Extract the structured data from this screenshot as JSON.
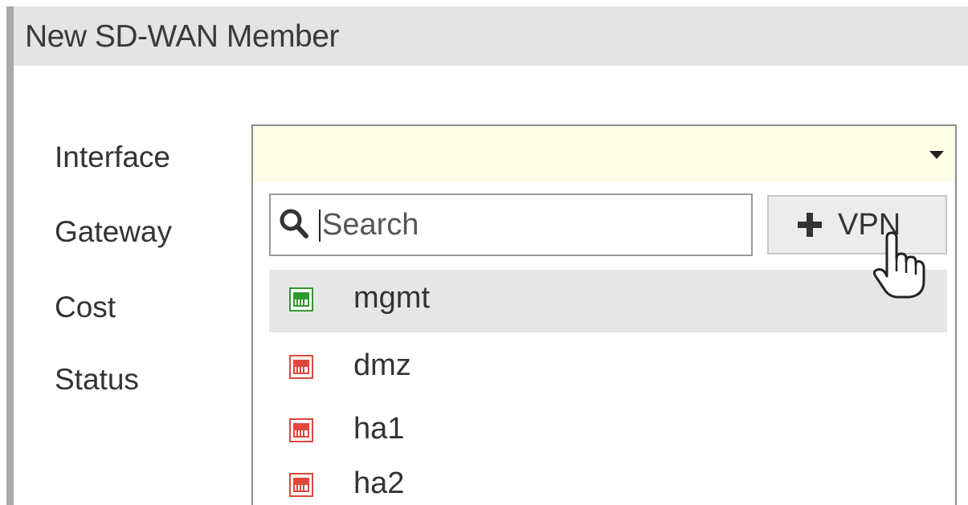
{
  "dialog": {
    "title": "New SD-WAN Member"
  },
  "form": {
    "labels": {
      "interface": "Interface",
      "gateway": "Gateway",
      "cost": "Cost",
      "status": "Status"
    },
    "interface_select": {
      "value": "",
      "icon": "chevron-down-icon"
    }
  },
  "dropdown": {
    "search": {
      "placeholder": "Search",
      "value": "",
      "icon": "search-icon"
    },
    "add_vpn_button": {
      "label": "VPN",
      "icon": "plus-icon"
    },
    "options": [
      {
        "label": "mgmt",
        "status": "up",
        "color": "#2e9b2e",
        "selected": true
      },
      {
        "label": "dmz",
        "status": "down",
        "color": "#e0463c",
        "selected": false
      },
      {
        "label": "ha1",
        "status": "down",
        "color": "#e0463c",
        "selected": false
      },
      {
        "label": "ha2",
        "status": "down",
        "color": "#e0463c",
        "selected": false
      }
    ]
  },
  "cursor": {
    "icon": "hand-pointer-icon"
  },
  "colors": {
    "titlebar": "#e4e4e4",
    "select_background": "#fdfde8",
    "selected_option": "#e6e6e6",
    "port_up": "#2e9b2e",
    "port_down": "#e0463c"
  }
}
